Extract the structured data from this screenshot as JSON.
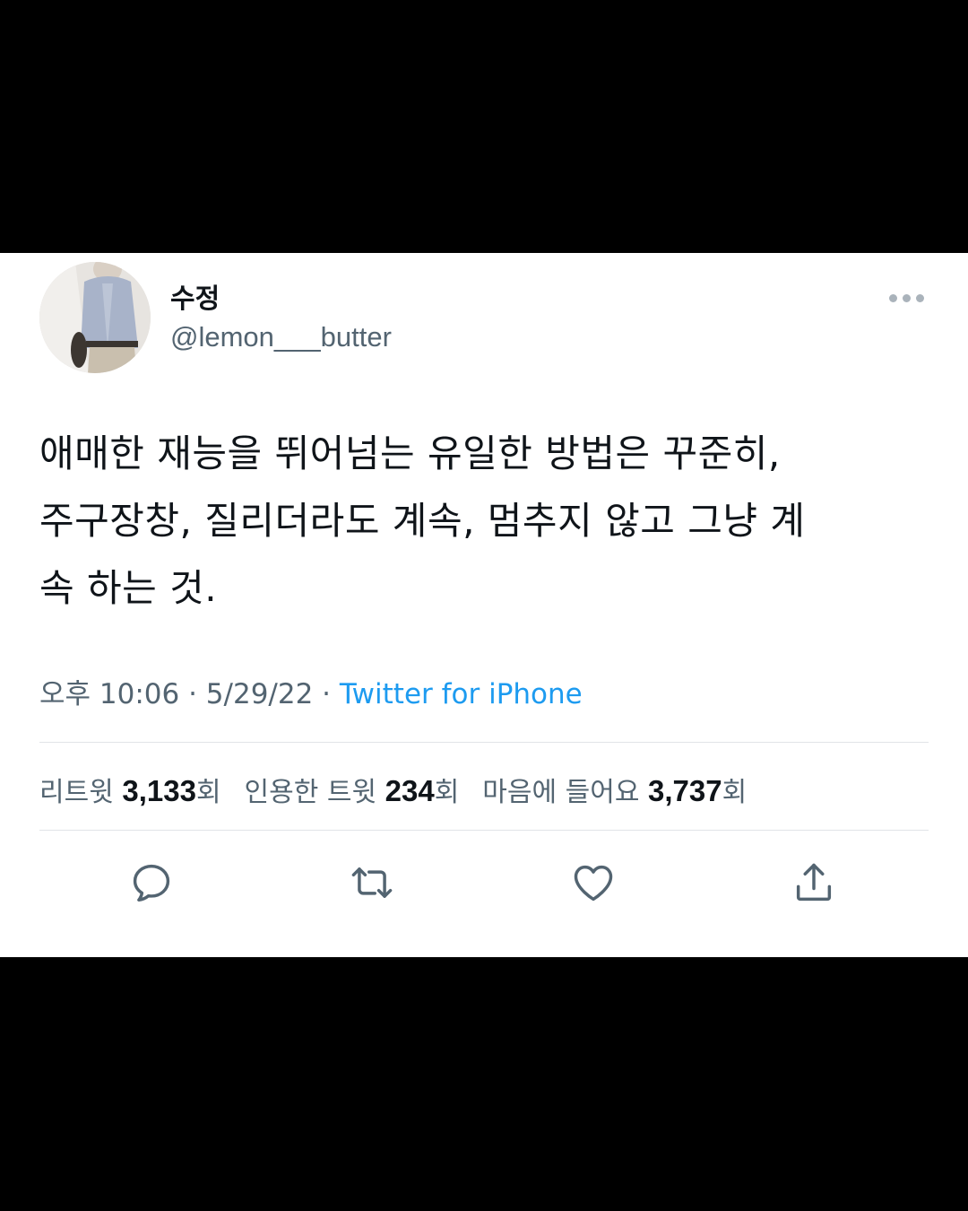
{
  "tweet": {
    "display_name": "수정",
    "handle": "@lemon___butter",
    "text_lines": [
      "애매한 재능을 뛰어넘는 유일한 방법은 꾸준히,",
      "주구장창, 질리더라도 계속, 멈추지 않고 그냥 계",
      "속 하는 것."
    ],
    "time": "오후 10:06",
    "date": "5/29/22",
    "source": "Twitter for iPhone",
    "separator": " · "
  },
  "stats": {
    "retweets": {
      "label": "리트윗 ",
      "count": "3,133",
      "unit": "회"
    },
    "quotes": {
      "label": "인용한 트윗 ",
      "count": "234",
      "unit": "회"
    },
    "likes": {
      "label": "마음에 들어요 ",
      "count": "3,737",
      "unit": "회"
    }
  },
  "icons": {
    "more": "more-horizontal-icon",
    "reply": "reply-icon",
    "retweet": "retweet-icon",
    "like": "heart-icon",
    "share": "share-icon"
  },
  "colors": {
    "link": "#1d9bf0",
    "secondary_text": "#536471",
    "primary_text": "#0f1419",
    "icon": "#536471"
  }
}
